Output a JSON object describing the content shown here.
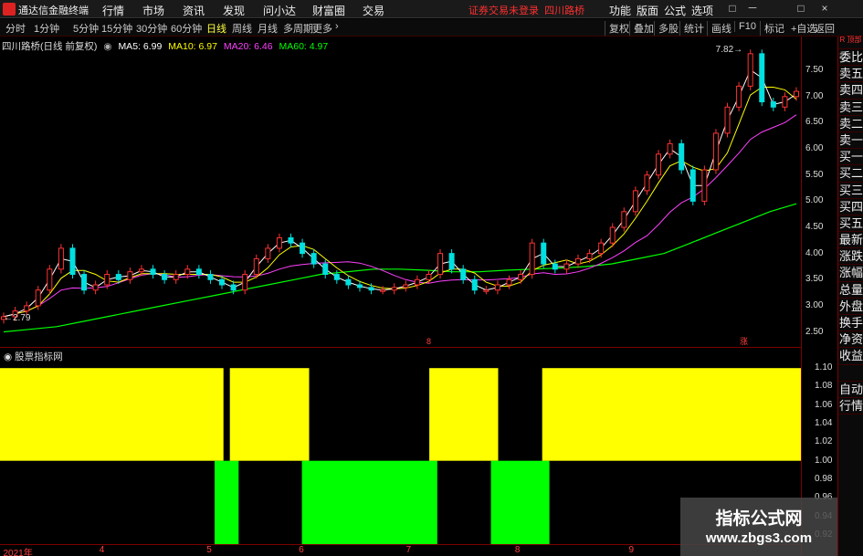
{
  "titlebar": {
    "app_title": "通达信金融终端",
    "menu": [
      "行情",
      "市场",
      "资讯",
      "发现",
      "问小达",
      "财富圈",
      "交易"
    ],
    "notice": "证券交易未登录",
    "stock_tag": "四川路桥",
    "right_menu": [
      "功能",
      "版面",
      "公式",
      "选项"
    ],
    "window_buttons": [
      "□",
      "－",
      "□",
      "×"
    ]
  },
  "toolbar": {
    "periods": [
      "分时",
      "1分钟",
      "5分钟",
      "15分钟",
      "30分钟",
      "60分钟",
      "日线",
      "周线",
      "月线",
      "多周期",
      "更多"
    ],
    "active_period": "日线",
    "buttons": [
      "复权",
      "叠加",
      "多股",
      "统计",
      "画线",
      "F10",
      "标记"
    ],
    "self_select": "+自选",
    "back": "返回"
  },
  "info": {
    "stock": "四川路桥(日线 前复权)",
    "ma5": "MA5: 6.99",
    "ma10": "MA10: 6.97",
    "ma20": "MA20: 6.46",
    "ma60": "MA60: 4.97",
    "indicator_name": "股票指标网",
    "low_label": "2.79",
    "high_label": "7.82",
    "marker_label": "8",
    "marker_label2": "涨"
  },
  "colors": {
    "up": "#ff3232",
    "down": "#00e0e0",
    "ma5": "#ffffff",
    "ma10": "#ffff00",
    "ma20": "#ff40ff",
    "ma60": "#00ff00",
    "ind_yellow": "#ffff00",
    "ind_green": "#00ff00"
  },
  "price_axis": [
    "7.50",
    "7.00",
    "6.50",
    "6.00",
    "5.50",
    "5.00",
    "4.50",
    "4.00",
    "3.50",
    "3.00",
    "2.50"
  ],
  "indicator_axis": [
    "1.10",
    "1.08",
    "1.06",
    "1.04",
    "1.02",
    "1.00",
    "0.98",
    "0.96",
    "0.94",
    "0.92"
  ],
  "date_axis": [
    "2021年",
    "4",
    "5",
    "6",
    "7",
    "8",
    "9"
  ],
  "side_panel": {
    "top_label": "R 顶部",
    "items": [
      "委比",
      "卖五",
      "卖四",
      "卖三",
      "卖二",
      "卖一",
      "买一",
      "买二",
      "买三",
      "买四",
      "买五",
      "最新",
      "涨跌",
      "涨幅",
      "总量",
      "外盘",
      "换手",
      "净资",
      "收益",
      "",
      "自动",
      "行情"
    ]
  },
  "watermark": {
    "title": "指标公式网",
    "url": "www.zbgs3.com"
  },
  "chart_data": {
    "type": "candlestick+step",
    "ma_legend": [
      "MA5",
      "MA10",
      "MA20",
      "MA60"
    ],
    "price_ylim": [
      2.3,
      7.8
    ],
    "price_points": [
      2.79,
      2.9,
      3.0,
      3.3,
      3.7,
      4.1,
      3.6,
      3.3,
      3.4,
      3.6,
      3.5,
      3.65,
      3.7,
      3.6,
      3.5,
      3.6,
      3.7,
      3.6,
      3.5,
      3.4,
      3.3,
      3.6,
      3.9,
      4.1,
      4.3,
      4.2,
      4.0,
      3.8,
      3.6,
      3.5,
      3.4,
      3.35,
      3.3,
      3.3,
      3.35,
      3.4,
      3.5,
      3.6,
      4.0,
      3.7,
      3.5,
      3.3,
      3.3,
      3.4,
      3.5,
      3.6,
      4.2,
      3.8,
      3.7,
      3.8,
      3.9,
      4.0,
      4.2,
      4.5,
      4.8,
      5.2,
      5.5,
      5.9,
      6.1,
      5.6,
      5.0,
      5.6,
      6.3,
      6.8,
      7.2,
      7.82,
      6.9,
      6.8,
      7.0,
      7.1
    ],
    "ma60": [
      2.5,
      2.55,
      2.6,
      2.7,
      2.8,
      2.9,
      3.0,
      3.1,
      3.2,
      3.3,
      3.4,
      3.5,
      3.6,
      3.65,
      3.7,
      3.7,
      3.68,
      3.65,
      3.65,
      3.68,
      3.7,
      3.72,
      3.75,
      3.8,
      3.9,
      4.0,
      4.2,
      4.4,
      4.6,
      4.8,
      4.95
    ],
    "indicator_ylim": [
      0.91,
      1.11
    ],
    "indicator_segments": [
      {
        "color": "yellow",
        "from": 0.0,
        "to": 0.279,
        "low": 1.0,
        "high": 1.1
      },
      {
        "color": "green",
        "from": 0.268,
        "to": 0.298,
        "low": 0.91,
        "high": 1.0
      },
      {
        "color": "yellow",
        "from": 0.287,
        "to": 0.386,
        "low": 1.0,
        "high": 1.1
      },
      {
        "color": "green",
        "from": 0.377,
        "to": 0.546,
        "low": 0.91,
        "high": 1.0
      },
      {
        "color": "yellow",
        "from": 0.536,
        "to": 0.622,
        "low": 1.0,
        "high": 1.1
      },
      {
        "color": "green",
        "from": 0.613,
        "to": 0.686,
        "low": 0.91,
        "high": 1.0
      },
      {
        "color": "yellow",
        "from": 0.677,
        "to": 1.0,
        "low": 1.0,
        "high": 1.1
      }
    ]
  }
}
